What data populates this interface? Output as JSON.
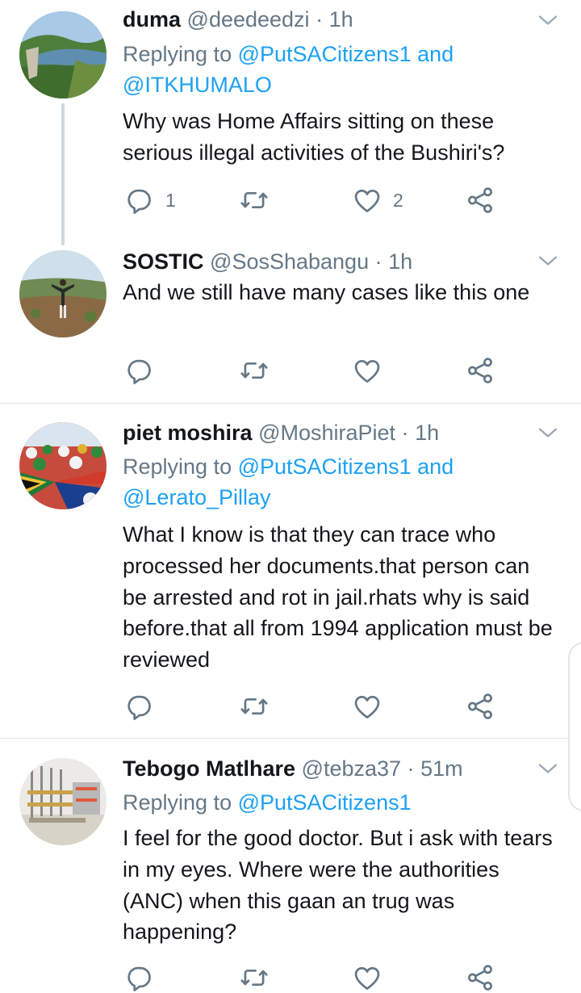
{
  "tweets": [
    {
      "name": "duma",
      "handle": "@deedeedzi",
      "time": "1h",
      "replying_prefix": "Replying to",
      "mention_line1": "@PutSACitizens1 and",
      "mention_line2": "@ITKHUMALO",
      "text": "Why was Home Affairs sitting on these serious illegal activities of the Bushiri's?",
      "reply_count": "1",
      "retweet_count": "",
      "like_count": "2"
    },
    {
      "name": "SOSTIC",
      "handle": "@SosShabangu",
      "time": "1h",
      "text": "And we still have many cases like this one",
      "reply_count": "",
      "retweet_count": "",
      "like_count": ""
    },
    {
      "name": "piet moshira",
      "handle": "@MoshiraPiet",
      "time": "1h",
      "replying_prefix": "Replying to",
      "mention_line1": "@PutSACitizens1 and",
      "mention_line2": "@Lerato_Pillay",
      "text": "What I know is that they can trace who processed her documents.that person can be arrested and rot in jail.rhats why is said before.that all from 1994 application must be reviewed",
      "reply_count": "",
      "retweet_count": "",
      "like_count": ""
    },
    {
      "name": "Tebogo Matlhare",
      "handle": "@tebza37",
      "time": "51m",
      "replying_prefix": "Replying to",
      "mention_line1": "@PutSACitizens1",
      "text": "I feel for the good doctor. But i ask with tears in my eyes. Where were the authorities (ANC) when this gaan an trug was happening?",
      "reply_count": "",
      "retweet_count": "",
      "like_count": ""
    }
  ],
  "separator": "·",
  "icons": {
    "reply": "reply-icon",
    "retweet": "retweet-icon",
    "like": "heart-icon",
    "share": "share-icon",
    "more": "chevron-down-icon"
  },
  "colors": {
    "text": "#14171a",
    "secondary": "#657786",
    "link": "#1da1f2",
    "divider": "#dfe3e7"
  }
}
